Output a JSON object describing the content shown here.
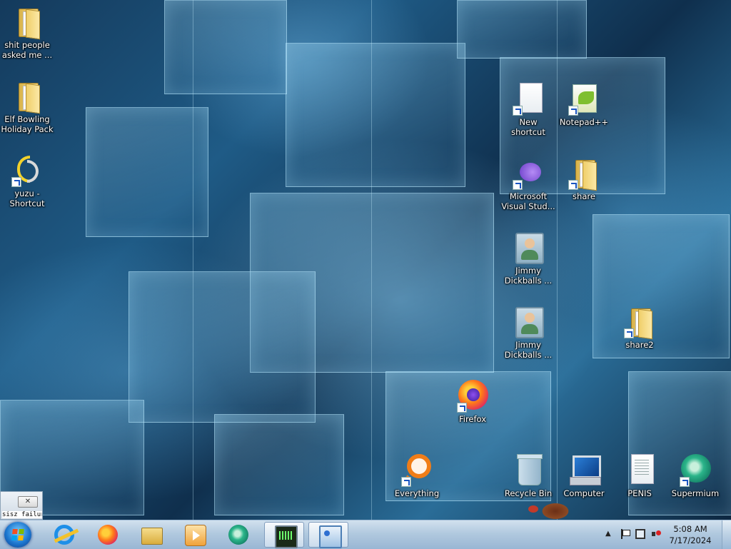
{
  "desktop": {
    "icons": [
      {
        "id": "shit-people",
        "label": "shit people asked me ...",
        "icon": "folder-icon",
        "shortcut": false
      },
      {
        "id": "elf-bowling",
        "label": "Elf Bowling Holiday Pack",
        "icon": "folder-icon",
        "shortcut": false
      },
      {
        "id": "yuzu",
        "label": "yuzu - Shortcut",
        "icon": "yuzu-icon",
        "shortcut": true
      },
      {
        "id": "new-shortcut",
        "label": "New shortcut",
        "icon": "document-icon",
        "shortcut": true
      },
      {
        "id": "notepadpp",
        "label": "Notepad++",
        "icon": "notepadpp-icon",
        "shortcut": true
      },
      {
        "id": "visual-studio",
        "label": "Microsoft Visual Stud...",
        "icon": "visual-studio-icon",
        "shortcut": true
      },
      {
        "id": "share",
        "label": "share",
        "icon": "folder-icon",
        "shortcut": true
      },
      {
        "id": "jimmy-1",
        "label": "Jimmy Dickballs ...",
        "icon": "contact-card-icon",
        "shortcut": false
      },
      {
        "id": "jimmy-2",
        "label": "Jimmy Dickballs ...",
        "icon": "contact-card-icon",
        "shortcut": false
      },
      {
        "id": "share2",
        "label": "share2",
        "icon": "network-folder-icon",
        "shortcut": true
      },
      {
        "id": "firefox",
        "label": "Firefox",
        "icon": "firefox-icon",
        "shortcut": true
      },
      {
        "id": "everything",
        "label": "Everything",
        "icon": "everything-search-icon",
        "shortcut": true
      },
      {
        "id": "recycle-bin",
        "label": "Recycle Bin",
        "icon": "recycle-bin-icon",
        "shortcut": false
      },
      {
        "id": "computer",
        "label": "Computer",
        "icon": "computer-icon",
        "shortcut": false
      },
      {
        "id": "penis",
        "label": "PENIS",
        "icon": "text-file-icon",
        "shortcut": false
      },
      {
        "id": "supermium",
        "label": "Supermium",
        "icon": "supermium-icon",
        "shortcut": true
      }
    ]
  },
  "mini_window": {
    "close_label": "✕",
    "text": "sisz failuret"
  },
  "taskbar": {
    "start_icon": "windows-start-icon",
    "buttons": [
      {
        "id": "ie",
        "icon": "internet-explorer-icon",
        "active": false
      },
      {
        "id": "firefox",
        "icon": "firefox-icon",
        "active": false
      },
      {
        "id": "explorer",
        "icon": "folder-icon",
        "active": false
      },
      {
        "id": "media",
        "icon": "media-player-icon",
        "active": false
      },
      {
        "id": "supermium",
        "icon": "supermium-icon",
        "active": false
      },
      {
        "id": "task-manager",
        "icon": "task-manager-icon",
        "active": true
      },
      {
        "id": "remote-desktop",
        "icon": "remote-desktop-icon",
        "active": true
      }
    ],
    "tray": {
      "show_hidden_label": "▲",
      "time": "5:08 AM",
      "date": "7/17/2024"
    }
  }
}
